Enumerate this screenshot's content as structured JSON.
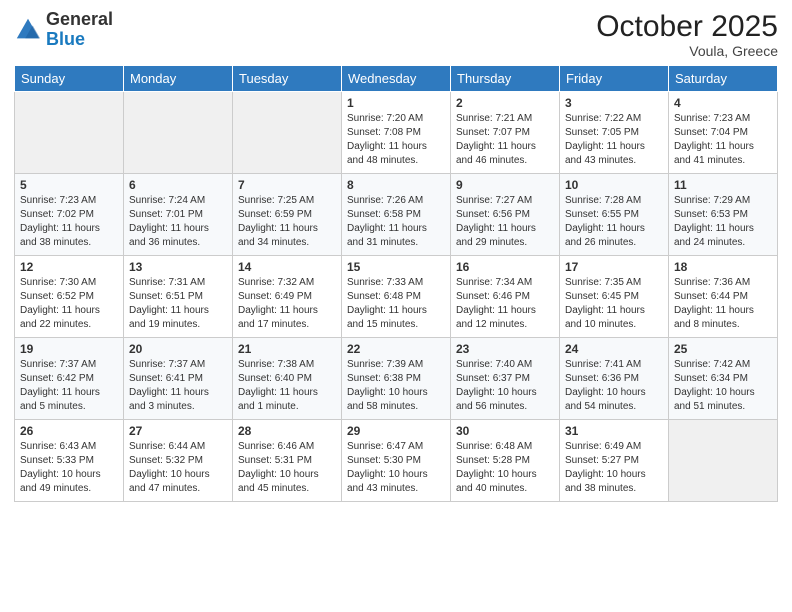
{
  "header": {
    "logo_general": "General",
    "logo_blue": "Blue",
    "month_title": "October 2025",
    "location": "Voula, Greece"
  },
  "days_of_week": [
    "Sunday",
    "Monday",
    "Tuesday",
    "Wednesday",
    "Thursday",
    "Friday",
    "Saturday"
  ],
  "weeks": [
    [
      {
        "day": "",
        "info": ""
      },
      {
        "day": "",
        "info": ""
      },
      {
        "day": "",
        "info": ""
      },
      {
        "day": "1",
        "info": "Sunrise: 7:20 AM\nSunset: 7:08 PM\nDaylight: 11 hours\nand 48 minutes."
      },
      {
        "day": "2",
        "info": "Sunrise: 7:21 AM\nSunset: 7:07 PM\nDaylight: 11 hours\nand 46 minutes."
      },
      {
        "day": "3",
        "info": "Sunrise: 7:22 AM\nSunset: 7:05 PM\nDaylight: 11 hours\nand 43 minutes."
      },
      {
        "day": "4",
        "info": "Sunrise: 7:23 AM\nSunset: 7:04 PM\nDaylight: 11 hours\nand 41 minutes."
      }
    ],
    [
      {
        "day": "5",
        "info": "Sunrise: 7:23 AM\nSunset: 7:02 PM\nDaylight: 11 hours\nand 38 minutes."
      },
      {
        "day": "6",
        "info": "Sunrise: 7:24 AM\nSunset: 7:01 PM\nDaylight: 11 hours\nand 36 minutes."
      },
      {
        "day": "7",
        "info": "Sunrise: 7:25 AM\nSunset: 6:59 PM\nDaylight: 11 hours\nand 34 minutes."
      },
      {
        "day": "8",
        "info": "Sunrise: 7:26 AM\nSunset: 6:58 PM\nDaylight: 11 hours\nand 31 minutes."
      },
      {
        "day": "9",
        "info": "Sunrise: 7:27 AM\nSunset: 6:56 PM\nDaylight: 11 hours\nand 29 minutes."
      },
      {
        "day": "10",
        "info": "Sunrise: 7:28 AM\nSunset: 6:55 PM\nDaylight: 11 hours\nand 26 minutes."
      },
      {
        "day": "11",
        "info": "Sunrise: 7:29 AM\nSunset: 6:53 PM\nDaylight: 11 hours\nand 24 minutes."
      }
    ],
    [
      {
        "day": "12",
        "info": "Sunrise: 7:30 AM\nSunset: 6:52 PM\nDaylight: 11 hours\nand 22 minutes."
      },
      {
        "day": "13",
        "info": "Sunrise: 7:31 AM\nSunset: 6:51 PM\nDaylight: 11 hours\nand 19 minutes."
      },
      {
        "day": "14",
        "info": "Sunrise: 7:32 AM\nSunset: 6:49 PM\nDaylight: 11 hours\nand 17 minutes."
      },
      {
        "day": "15",
        "info": "Sunrise: 7:33 AM\nSunset: 6:48 PM\nDaylight: 11 hours\nand 15 minutes."
      },
      {
        "day": "16",
        "info": "Sunrise: 7:34 AM\nSunset: 6:46 PM\nDaylight: 11 hours\nand 12 minutes."
      },
      {
        "day": "17",
        "info": "Sunrise: 7:35 AM\nSunset: 6:45 PM\nDaylight: 11 hours\nand 10 minutes."
      },
      {
        "day": "18",
        "info": "Sunrise: 7:36 AM\nSunset: 6:44 PM\nDaylight: 11 hours\nand 8 minutes."
      }
    ],
    [
      {
        "day": "19",
        "info": "Sunrise: 7:37 AM\nSunset: 6:42 PM\nDaylight: 11 hours\nand 5 minutes."
      },
      {
        "day": "20",
        "info": "Sunrise: 7:37 AM\nSunset: 6:41 PM\nDaylight: 11 hours\nand 3 minutes."
      },
      {
        "day": "21",
        "info": "Sunrise: 7:38 AM\nSunset: 6:40 PM\nDaylight: 11 hours\nand 1 minute."
      },
      {
        "day": "22",
        "info": "Sunrise: 7:39 AM\nSunset: 6:38 PM\nDaylight: 10 hours\nand 58 minutes."
      },
      {
        "day": "23",
        "info": "Sunrise: 7:40 AM\nSunset: 6:37 PM\nDaylight: 10 hours\nand 56 minutes."
      },
      {
        "day": "24",
        "info": "Sunrise: 7:41 AM\nSunset: 6:36 PM\nDaylight: 10 hours\nand 54 minutes."
      },
      {
        "day": "25",
        "info": "Sunrise: 7:42 AM\nSunset: 6:34 PM\nDaylight: 10 hours\nand 51 minutes."
      }
    ],
    [
      {
        "day": "26",
        "info": "Sunrise: 6:43 AM\nSunset: 5:33 PM\nDaylight: 10 hours\nand 49 minutes."
      },
      {
        "day": "27",
        "info": "Sunrise: 6:44 AM\nSunset: 5:32 PM\nDaylight: 10 hours\nand 47 minutes."
      },
      {
        "day": "28",
        "info": "Sunrise: 6:46 AM\nSunset: 5:31 PM\nDaylight: 10 hours\nand 45 minutes."
      },
      {
        "day": "29",
        "info": "Sunrise: 6:47 AM\nSunset: 5:30 PM\nDaylight: 10 hours\nand 43 minutes."
      },
      {
        "day": "30",
        "info": "Sunrise: 6:48 AM\nSunset: 5:28 PM\nDaylight: 10 hours\nand 40 minutes."
      },
      {
        "day": "31",
        "info": "Sunrise: 6:49 AM\nSunset: 5:27 PM\nDaylight: 10 hours\nand 38 minutes."
      },
      {
        "day": "",
        "info": ""
      }
    ]
  ]
}
